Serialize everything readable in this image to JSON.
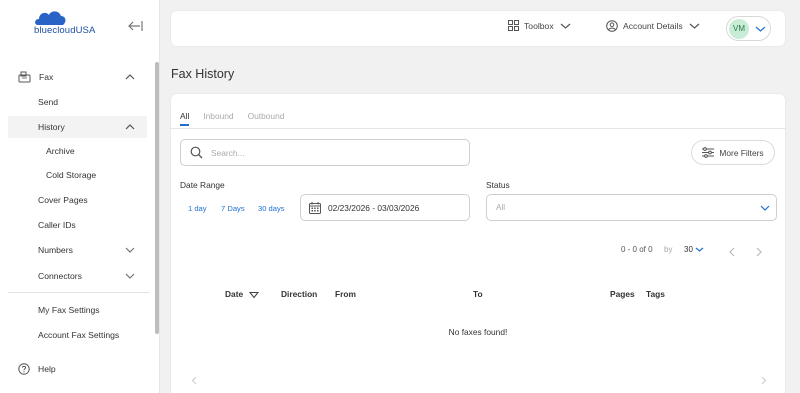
{
  "app": {
    "logo_text": "bluecloudUSA",
    "brand_color": "#1e4fa1",
    "accent_color": "#1f6fd1"
  },
  "sidebar": {
    "items": [
      {
        "label": "Fax",
        "icon": "fax-icon",
        "expanded": true
      },
      {
        "label": "Send"
      },
      {
        "label": "History",
        "expanded": true
      },
      {
        "label": "Archive"
      },
      {
        "label": "Cold Storage"
      },
      {
        "label": "Cover Pages"
      },
      {
        "label": "Caller IDs"
      },
      {
        "label": "Numbers",
        "expanded": false
      },
      {
        "label": "Connectors",
        "expanded": false
      },
      {
        "label": "My Fax Settings"
      },
      {
        "label": "Account Fax Settings"
      }
    ],
    "help_label": "Help"
  },
  "topbar": {
    "toolbox_label": "Toolbox",
    "account_label": "Account Details",
    "avatar_initials": "VM"
  },
  "main": {
    "title": "Fax History",
    "tabs": [
      {
        "label": "All",
        "active": true
      },
      {
        "label": "Inbound",
        "active": false
      },
      {
        "label": "Outbound",
        "active": false
      }
    ],
    "search_placeholder": "Search...",
    "more_filters_label": "More Filters",
    "date_range_label": "Date Range",
    "quick_ranges": [
      "1 day",
      "7 Days",
      "30 days"
    ],
    "date_range_value": "02/23/2026 - 03/03/2026",
    "status_label": "Status",
    "status_value": "All",
    "pager": {
      "count": "0 - 0 of 0",
      "by": "by",
      "page_size": "30"
    },
    "columns": [
      "Date",
      "Direction",
      "From",
      "To",
      "Pages",
      "Tags"
    ],
    "empty_message": "No faxes found!"
  }
}
